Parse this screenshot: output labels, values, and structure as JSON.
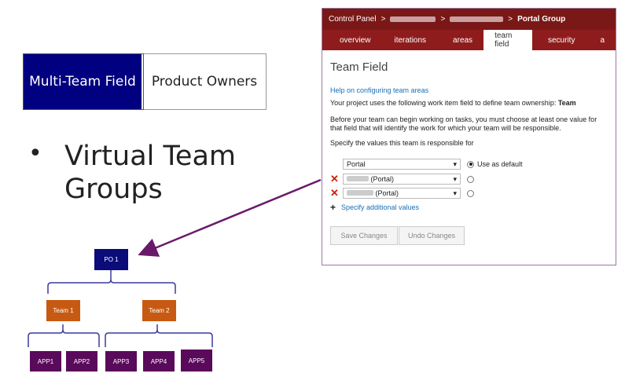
{
  "tags": {
    "left": "Multi-Team Field",
    "right": "Product Owners"
  },
  "bullet": {
    "dot": "•",
    "text": "Virtual Team Groups"
  },
  "panel": {
    "breadcrumb": {
      "root": "Control Panel",
      "sep": ">",
      "current": "Portal Group"
    },
    "tabs": [
      "overview",
      "iterations",
      "areas",
      "team field",
      "security",
      "a"
    ],
    "active_tab": "team field",
    "title": "Team Field",
    "help_link": "Help on configuring team areas",
    "line1_prefix": "Your project uses the following work item field to define team ownership: ",
    "line1_field": "Team",
    "line2": "Before your team can begin working on tasks, you must choose at least one value for that field that will identify the work for which your team will be responsible.",
    "line3": "Specify the values this team is responsible for",
    "values": [
      {
        "label": "Portal",
        "default_label": "Use as default",
        "removable": false
      },
      {
        "label": "(Portal)",
        "removable": true
      },
      {
        "label": "(Portal)",
        "removable": true
      }
    ],
    "add_link": "Specify additional values",
    "save_label": "Save Changes",
    "undo_label": "Undo Changes",
    "colors": {
      "header": "#7a1818",
      "tabs": "#8e1c1c",
      "link": "#1a6fb5"
    }
  },
  "org": {
    "root": "PO 1",
    "teams": [
      "Team 1",
      "Team 2"
    ],
    "apps": [
      "APP1",
      "APP2",
      "APP3",
      "APP4",
      "APP5"
    ],
    "colors": {
      "root": "#0b0b7a",
      "team": "#c75a12",
      "app": "#5a0a5a",
      "arrow": "#6a1a6a"
    }
  }
}
